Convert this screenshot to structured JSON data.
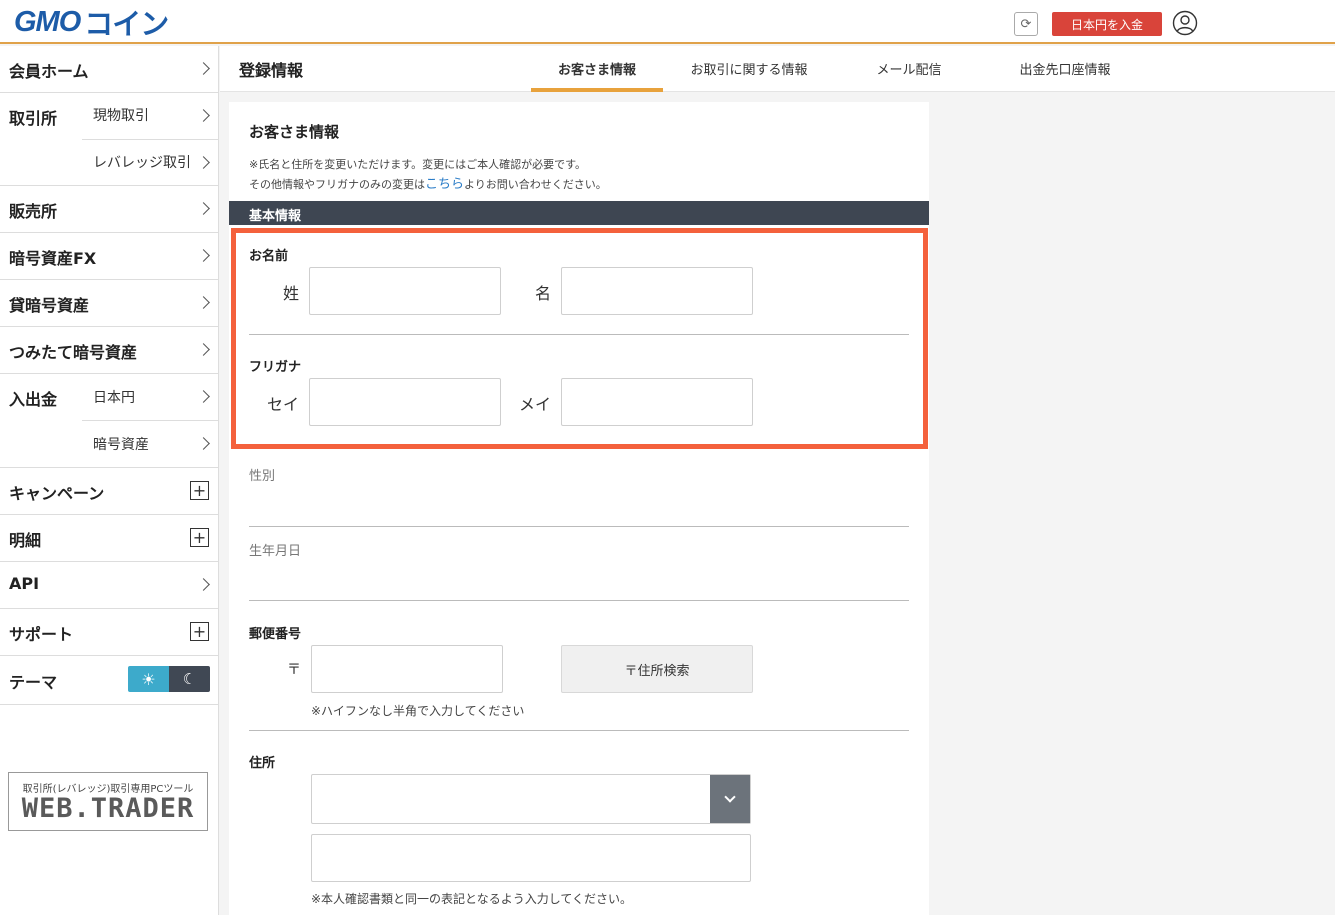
{
  "header": {
    "logo_gmo": "GMO",
    "logo_coin": "コイン",
    "deposit_label": "日本円を入金",
    "icons": {
      "refresh": "refresh-icon",
      "user": "user-icon"
    },
    "deposit_color": "#d9443a"
  },
  "sidebar": {
    "member_home": "会員ホーム",
    "exchange": "取引所",
    "spot": "現物取引",
    "leverage": "レバレッジ取引",
    "sales": "販売所",
    "fx": "暗号資産FX",
    "lending": "貸暗号資産",
    "tsumitate": "つみたて暗号資産",
    "deposit_withdraw": "入出金",
    "jpy": "日本円",
    "crypto": "暗号資産",
    "campaign": "キャンペーン",
    "statement": "明細",
    "api": "API",
    "support": "サポート",
    "theme": "テーマ",
    "webtrader_caption": "取引所(レバレッジ)取引専用PCツール",
    "webtrader_logo": "WEB.TRADER"
  },
  "tabs": {
    "section_title": "登録情報",
    "items": [
      "お客さま情報",
      "お取引に関する情報",
      "メール配信",
      "出金先口座情報"
    ],
    "active_color": "#e8a23c"
  },
  "form": {
    "title": "お客さま情報",
    "note1": "※氏名と住所を変更いただけます。変更にはご本人確認が必要です。",
    "note2_pre": "その他情報やフリガナのみの変更は",
    "note2_link": "こちら",
    "note2_post": "よりお問い合わせください。",
    "section": "基本情報",
    "name_label": "お名前",
    "last_name": "姓",
    "first_name": "名",
    "furigana_label": "フリガナ",
    "sei": "セイ",
    "mei": "メイ",
    "gender_label": "性別",
    "birthday_label": "生年月日",
    "postal_label": "郵便番号",
    "postal_mark": "〒",
    "postal_search": "〒住所検索",
    "postal_hint": "※ハイフンなし半角で入力してください",
    "address_label": "住所",
    "address_hint": "※本人確認書類と同一の表記となるよう入力してください。",
    "highlight_color": "#f4613c"
  }
}
